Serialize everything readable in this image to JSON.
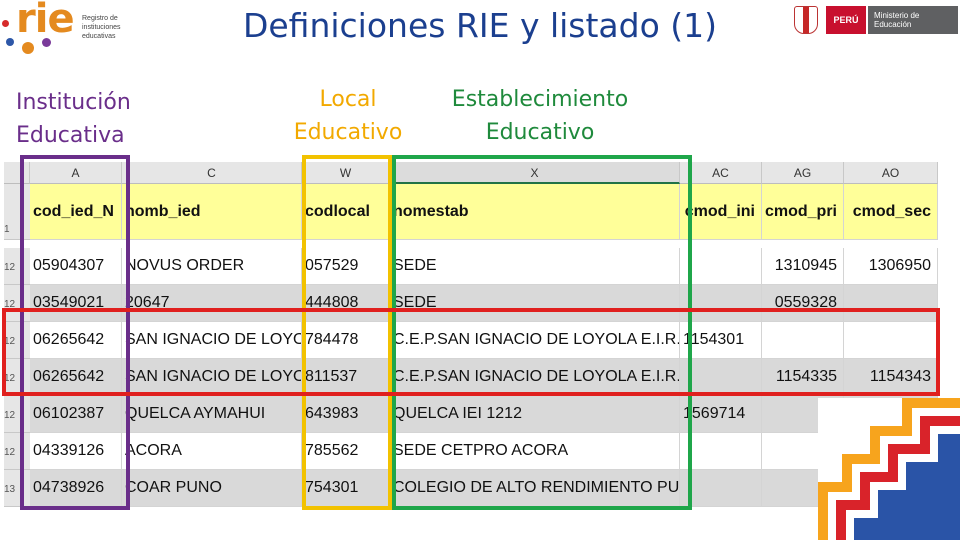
{
  "header": {
    "title": "Definiciones RIE y listado (1)",
    "rie_logo": {
      "word": "rie",
      "subtitle": "Registro de instituciones educativas"
    },
    "minedu": {
      "peru": "PERÚ",
      "ministry": "Ministerio de Educación"
    }
  },
  "labels": {
    "institucion": "Institución Educativa",
    "local": "Local Educativo",
    "establecimiento": "Establecimiento Educativo"
  },
  "sheet": {
    "columns": [
      "A",
      "C",
      "W",
      "X",
      "AC",
      "AG",
      "AO"
    ],
    "header_row_num": "1",
    "headers": [
      "cod_ied_N",
      "nomb_ied",
      "codlocal",
      "nomestab",
      "cmod_ini",
      "cmod_pri",
      "cmod_sec"
    ],
    "rows": [
      {
        "num": "12",
        "cells": [
          "05904307",
          "NOVUS ORDER",
          "057529",
          "SEDE",
          "",
          "1310945",
          "1306950"
        ]
      },
      {
        "num": "12",
        "cells": [
          "03549021",
          "20647",
          "444808",
          "SEDE",
          "",
          "0559328",
          ""
        ]
      },
      {
        "num": "12",
        "cells": [
          "06265642",
          "SAN IGNACIO DE LOYOLA",
          "784478",
          "C.E.P.SAN IGNACIO DE LOYOLA E.I.R.L.",
          "1154301",
          "",
          ""
        ]
      },
      {
        "num": "12",
        "cells": [
          "06265642",
          "SAN IGNACIO DE LOYOLA",
          "811537",
          "C.E.P.SAN IGNACIO DE LOYOLA E.I.R.L.",
          "",
          "1154335",
          "1154343"
        ]
      },
      {
        "num": "12",
        "cells": [
          "06102387",
          "QUELCA AYMAHUI",
          "643983",
          "QUELCA IEI 1212",
          "1569714",
          "",
          ""
        ]
      },
      {
        "num": "12",
        "cells": [
          "04339126",
          "ACORA",
          "785562",
          "SEDE CETPRO ACORA",
          "",
          "",
          ""
        ]
      },
      {
        "num": "13",
        "cells": [
          "04738926",
          "COAR PUNO",
          "754301",
          "COLEGIO DE ALTO RENDIMIENTO PUNO",
          "",
          "",
          ""
        ]
      }
    ]
  },
  "colors": {
    "purple": "#6a2e8a",
    "yellow": "#f2c200",
    "green": "#1fa64a",
    "red": "#e0201e",
    "header_fill": "#ffff99",
    "title_blue": "#1b3f8f"
  }
}
